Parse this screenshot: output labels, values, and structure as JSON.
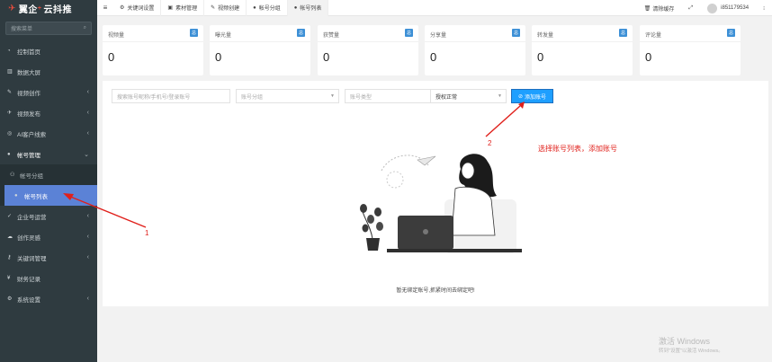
{
  "sidebar": {
    "logo_text": "翼企",
    "logo_plus": "+",
    "logo_suffix": "云抖推",
    "search_placeholder": "搜索菜单",
    "items": [
      {
        "label": "控制首页",
        "icon": "dashboard-icon"
      },
      {
        "label": "数据大屏",
        "icon": "chart-icon"
      },
      {
        "label": "视频创作",
        "icon": "edit-icon"
      },
      {
        "label": "视频发布",
        "icon": "send-icon"
      },
      {
        "label": "AI客户线索",
        "icon": "target-icon"
      },
      {
        "label": "帐号管理",
        "icon": "user-icon"
      },
      {
        "label": "帐号分组",
        "icon": "users-icon"
      },
      {
        "label": "帐号列表",
        "icon": "user-icon"
      },
      {
        "label": "企业号运营",
        "icon": "check-icon"
      },
      {
        "label": "创作灵感",
        "icon": "cloud-icon"
      },
      {
        "label": "关键词管理",
        "icon": "key-icon"
      },
      {
        "label": "财务记录",
        "icon": "yen-icon"
      },
      {
        "label": "系统设置",
        "icon": "gear-icon"
      }
    ]
  },
  "topbar": {
    "tabs": [
      {
        "label": "关键词设置",
        "icon": "gear-icon"
      },
      {
        "label": "素材管理",
        "icon": "image-icon"
      },
      {
        "label": "视频创建",
        "icon": "edit-icon"
      },
      {
        "label": "帐号分组",
        "icon": "user-icon"
      },
      {
        "label": "帐号列表",
        "icon": "user-icon"
      }
    ],
    "clear_cache": "清除缓存",
    "username": "i851179534"
  },
  "stats": [
    {
      "label": "视频量",
      "badge": "总",
      "value": "0"
    },
    {
      "label": "曝光量",
      "badge": "总",
      "value": "0"
    },
    {
      "label": "获赞量",
      "badge": "总",
      "value": "0"
    },
    {
      "label": "分享量",
      "badge": "总",
      "value": "0"
    },
    {
      "label": "转发量",
      "badge": "总",
      "value": "0"
    },
    {
      "label": "评论量",
      "badge": "总",
      "value": "0"
    }
  ],
  "filters": {
    "search_placeholder": "搜索账号昵称/手机号/登录账号",
    "group_placeholder": "账号分组",
    "type_placeholder": "账号类型",
    "auth_value": "授权正常"
  },
  "add_button_label": "添加账号",
  "empty_message": "暂无绑定账号,抓紧时间去绑定吧!",
  "annotations": {
    "label_1": "1",
    "label_2": "2",
    "instruction": "选择账号列表，添加账号"
  },
  "watermark": {
    "line1": "激活 Windows",
    "line2": "转到\"设置\"以激活 Windows。"
  },
  "colors": {
    "sidebar_bg": "#2f3b40",
    "active_item": "#5b82d6",
    "accent_button": "#1e9fff",
    "annotation": "#e0201b"
  }
}
